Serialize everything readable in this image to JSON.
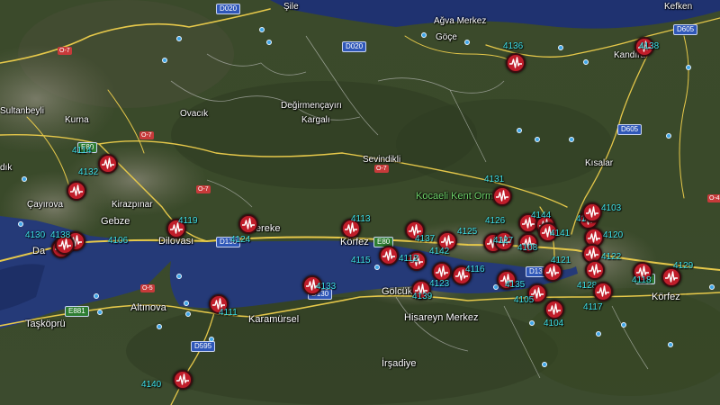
{
  "place_labels": [
    {
      "id": "sile",
      "text": "Şile"
    },
    {
      "id": "agva",
      "text": "Ağva Merkez"
    },
    {
      "id": "goce",
      "text": "Göçe"
    },
    {
      "id": "kefken",
      "text": "Kefken"
    },
    {
      "id": "kandira",
      "text": "Kandıra"
    },
    {
      "id": "sultanbeyli",
      "text": "Sultanbeyli"
    },
    {
      "id": "kurna",
      "text": "Kurna"
    },
    {
      "id": "ovacik",
      "text": "Ovacık"
    },
    {
      "id": "degirmen",
      "text": "Değirmençayırı"
    },
    {
      "id": "kargali",
      "text": "Kargalı"
    },
    {
      "id": "sevindikli",
      "text": "Sevindikli"
    },
    {
      "id": "kisalar",
      "text": "Kısalar"
    },
    {
      "id": "kocaeli",
      "text": "Kocaeli Kent Ormanı"
    },
    {
      "id": "kirazpinar",
      "text": "Kirazpınar"
    },
    {
      "id": "cayirova",
      "text": "Çayırova"
    },
    {
      "id": "gebze",
      "text": "Gebze"
    },
    {
      "id": "dilovasi",
      "text": "Dilovası"
    },
    {
      "id": "hereke",
      "text": "Hereke"
    },
    {
      "id": "korfez1",
      "text": "Körfez"
    },
    {
      "id": "korfez2",
      "text": "Körfez"
    },
    {
      "id": "golcuk",
      "text": "Gölcük"
    },
    {
      "id": "hisareyn",
      "text": "Hisareyn Merkez"
    },
    {
      "id": "karamursel",
      "text": "Karamürsel"
    },
    {
      "id": "altinova",
      "text": "Altınova"
    },
    {
      "id": "taskopru",
      "text": "Taşköprü"
    },
    {
      "id": "irsadiye",
      "text": "İrşadiye"
    },
    {
      "id": "dik",
      "text": "dık"
    },
    {
      "id": "darica",
      "text": "Da"
    }
  ],
  "road_shields": [
    {
      "id": "d020a",
      "text": "D020"
    },
    {
      "id": "d020b",
      "text": "D020"
    },
    {
      "id": "d605a",
      "text": "D605"
    },
    {
      "id": "d605b",
      "text": "D605"
    },
    {
      "id": "d130a",
      "text": "D130"
    },
    {
      "id": "d130b",
      "text": "D130"
    },
    {
      "id": "d130c",
      "text": "D130"
    },
    {
      "id": "d595",
      "text": "D595"
    },
    {
      "id": "e80a",
      "text": "E80"
    },
    {
      "id": "e80b",
      "text": "E80"
    },
    {
      "id": "e881",
      "text": "E881"
    },
    {
      "id": "e80c",
      "text": "E80"
    }
  ],
  "red_shields": [
    {
      "id": "o7a",
      "text": "O-7"
    },
    {
      "id": "o7b",
      "text": "O-7"
    },
    {
      "id": "o7c",
      "text": "O-7"
    },
    {
      "id": "o7d",
      "text": "O-7"
    },
    {
      "id": "o5",
      "text": "O-5"
    },
    {
      "id": "o4",
      "text": "O-4"
    }
  ],
  "stations": [
    {
      "id": "4136",
      "label": "4136"
    },
    {
      "id": "4138",
      "label": "4138"
    },
    {
      "id": "4114",
      "label": "4114"
    },
    {
      "id": "4132",
      "label": "4132"
    },
    {
      "id": "4130",
      "label": "4130"
    },
    {
      "id": "4106",
      "label": "4106"
    },
    {
      "id": "4119",
      "label": "4119"
    },
    {
      "id": "4124",
      "label": "4124"
    },
    {
      "id": "4113",
      "label": "4113"
    },
    {
      "id": "4137",
      "label": "4137"
    },
    {
      "id": "4115",
      "label": "4115"
    },
    {
      "id": "4112",
      "label": "4112"
    },
    {
      "id": "4142",
      "label": "4142"
    },
    {
      "id": "4116",
      "label": "4116"
    },
    {
      "id": "4123",
      "label": "4123"
    },
    {
      "id": "4139",
      "label": "4139"
    },
    {
      "id": "4133",
      "label": "4133"
    },
    {
      "id": "4111",
      "label": "4111"
    },
    {
      "id": "4140",
      "label": "4140"
    },
    {
      "id": "4131",
      "label": "4131"
    },
    {
      "id": "4126",
      "label": "4126"
    },
    {
      "id": "4125",
      "label": "4125"
    },
    {
      "id": "4127",
      "label": "4127"
    },
    {
      "id": "4108",
      "label": "4108"
    },
    {
      "id": "4135",
      "label": "4135"
    },
    {
      "id": "4105",
      "label": "4105"
    },
    {
      "id": "4104",
      "label": "4104"
    },
    {
      "id": "4144",
      "label": "4144"
    },
    {
      "id": "4141",
      "label": "4141"
    },
    {
      "id": "4121",
      "label": "4121"
    },
    {
      "id": "4102",
      "label": "4102"
    },
    {
      "id": "4103",
      "label": "4103"
    },
    {
      "id": "4120",
      "label": "4120"
    },
    {
      "id": "4122",
      "label": "4122"
    },
    {
      "id": "4128",
      "label": "4128"
    },
    {
      "id": "4117",
      "label": "4117"
    },
    {
      "id": "4118",
      "label": "4118"
    },
    {
      "id": "4129",
      "label": "4129"
    },
    {
      "id": "4138b",
      "label": "4138"
    }
  ],
  "colors": {
    "station": "#c01d2a",
    "station_label": "#3ee0e8",
    "road": "#e6c84a",
    "sea": "#253a78"
  }
}
